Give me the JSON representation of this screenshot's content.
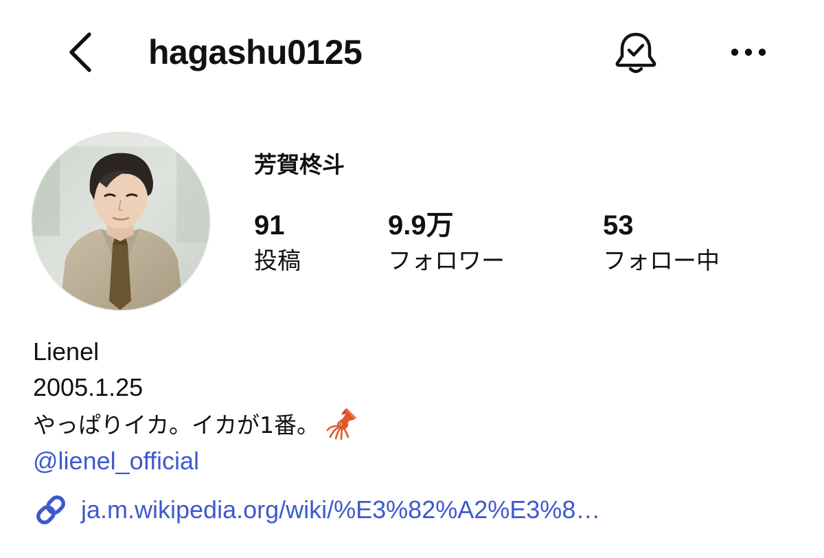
{
  "header": {
    "username": "hagashu0125",
    "back_icon": "chevron-left-icon",
    "bell_icon": "bell-check-icon",
    "more_icon": "ellipsis-icon"
  },
  "profile": {
    "display_name": "芳賀柊斗",
    "avatar": "profile-photo",
    "stats": {
      "posts": {
        "count": "91",
        "label": "投稿"
      },
      "followers": {
        "count": "9.9万",
        "label": "フォロワー"
      },
      "following": {
        "count": "53",
        "label": "フォロー中"
      }
    }
  },
  "bio": {
    "line1": "Lienel",
    "line2": "2005.1.25",
    "line3": "やっぱりイカ。イカが1番。",
    "line3_emoji": "squid",
    "mention": "@lienel_official",
    "link": "ja.m.wikipedia.org/wiki/%E3%82%A2%E3%8…",
    "link_icon": "link-icon"
  },
  "colors": {
    "text": "#111111",
    "link": "#3d59cc",
    "background": "#ffffff"
  }
}
